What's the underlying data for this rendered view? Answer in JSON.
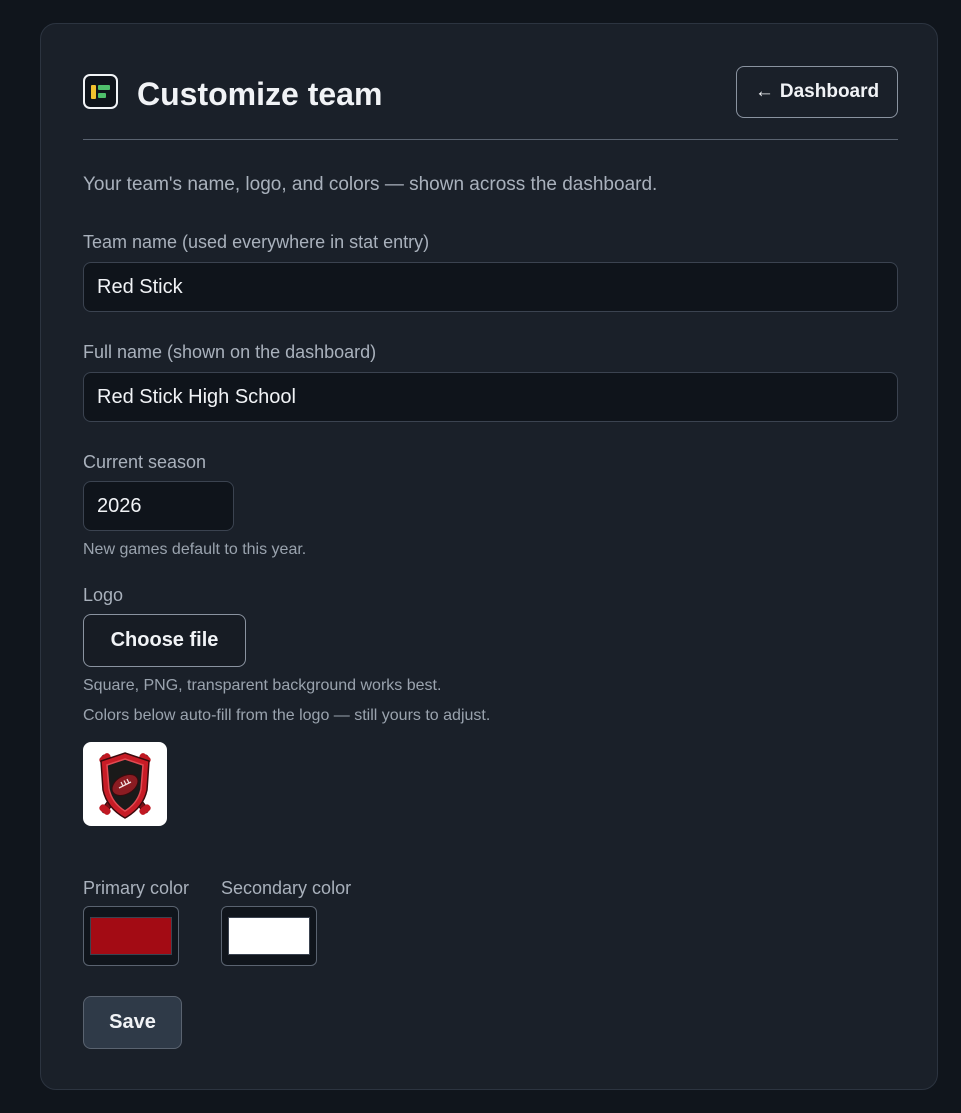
{
  "header": {
    "title": "Customize team",
    "back_button": {
      "arrow": "←",
      "label": "Dashboard"
    },
    "app_icon": "app-logo-icon"
  },
  "intro": "Your team's name, logo, and colors — shown across the dashboard.",
  "team_name": {
    "label": "Team name (used everywhere in stat entry)",
    "value": "Red Stick"
  },
  "full_name": {
    "label": "Full name (shown on the dashboard)",
    "value": "Red Stick High School"
  },
  "season": {
    "label": "Current season",
    "value": "2026",
    "hint": "New games default to this year."
  },
  "logo": {
    "label": "Logo",
    "button": "Choose file",
    "hint1": "Square, PNG, transparent background works best.",
    "hint2": "Colors below auto-fill from the logo — still yours to adjust.",
    "preview_icon": "team-shield-logo"
  },
  "colors": {
    "primary": {
      "label": "Primary color",
      "value": "#a30b14"
    },
    "secondary": {
      "label": "Secondary color",
      "value": "#ffffff"
    }
  },
  "save_label": "Save"
}
